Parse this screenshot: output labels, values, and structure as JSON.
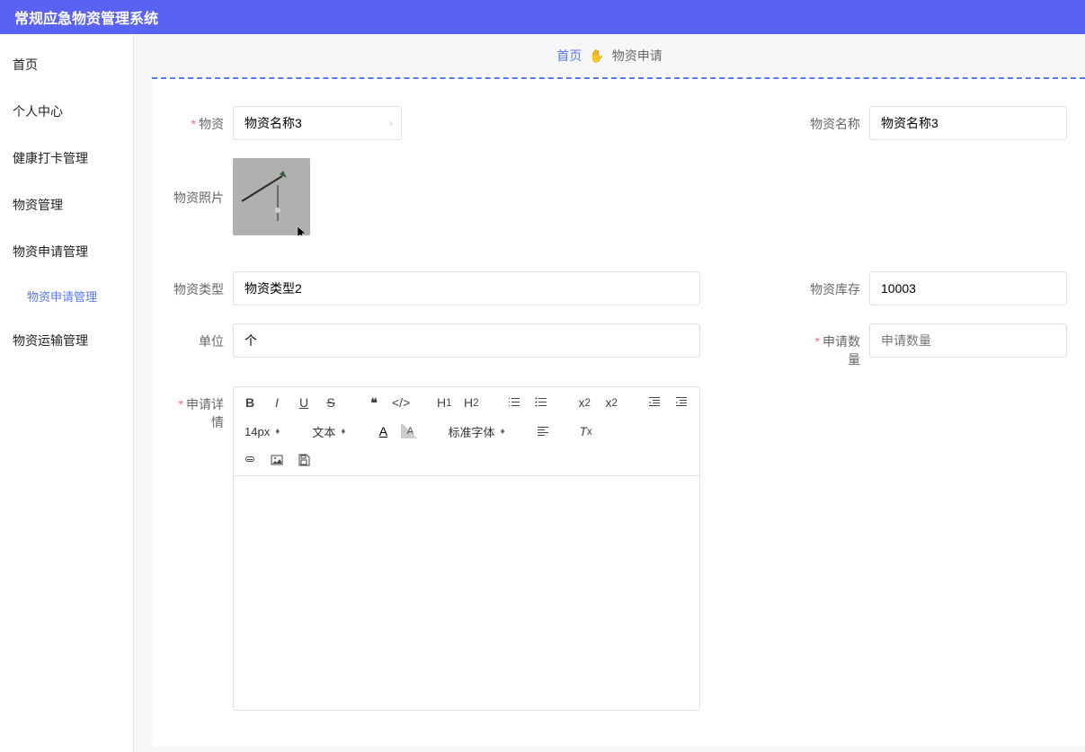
{
  "header": {
    "title": "常规应急物资管理系统"
  },
  "sidebar": {
    "items": [
      {
        "label": "首页"
      },
      {
        "label": "个人中心"
      },
      {
        "label": "健康打卡管理"
      },
      {
        "label": "物资管理"
      },
      {
        "label": "物资申请管理",
        "sub": [
          {
            "label": "物资申请管理"
          }
        ]
      },
      {
        "label": "物资运输管理"
      }
    ]
  },
  "breadcrumb": {
    "home": "首页",
    "current": "物资申请"
  },
  "form": {
    "material_label": "物资",
    "material_value": "物资名称3",
    "material_name_label": "物资名称",
    "material_name_value": "物资名称3",
    "image_label": "物资照片",
    "type_label": "物资类型",
    "type_value": "物资类型2",
    "stock_label": "物资库存",
    "stock_value": "10003",
    "unit_label": "单位",
    "unit_value": "个",
    "qty_label": "申请数量",
    "qty_placeholder": "申请数量",
    "detail_label": "申请详情"
  },
  "editor_toolbar": {
    "font_size": "14px",
    "text_style": "文本",
    "font_family": "标准字体"
  }
}
